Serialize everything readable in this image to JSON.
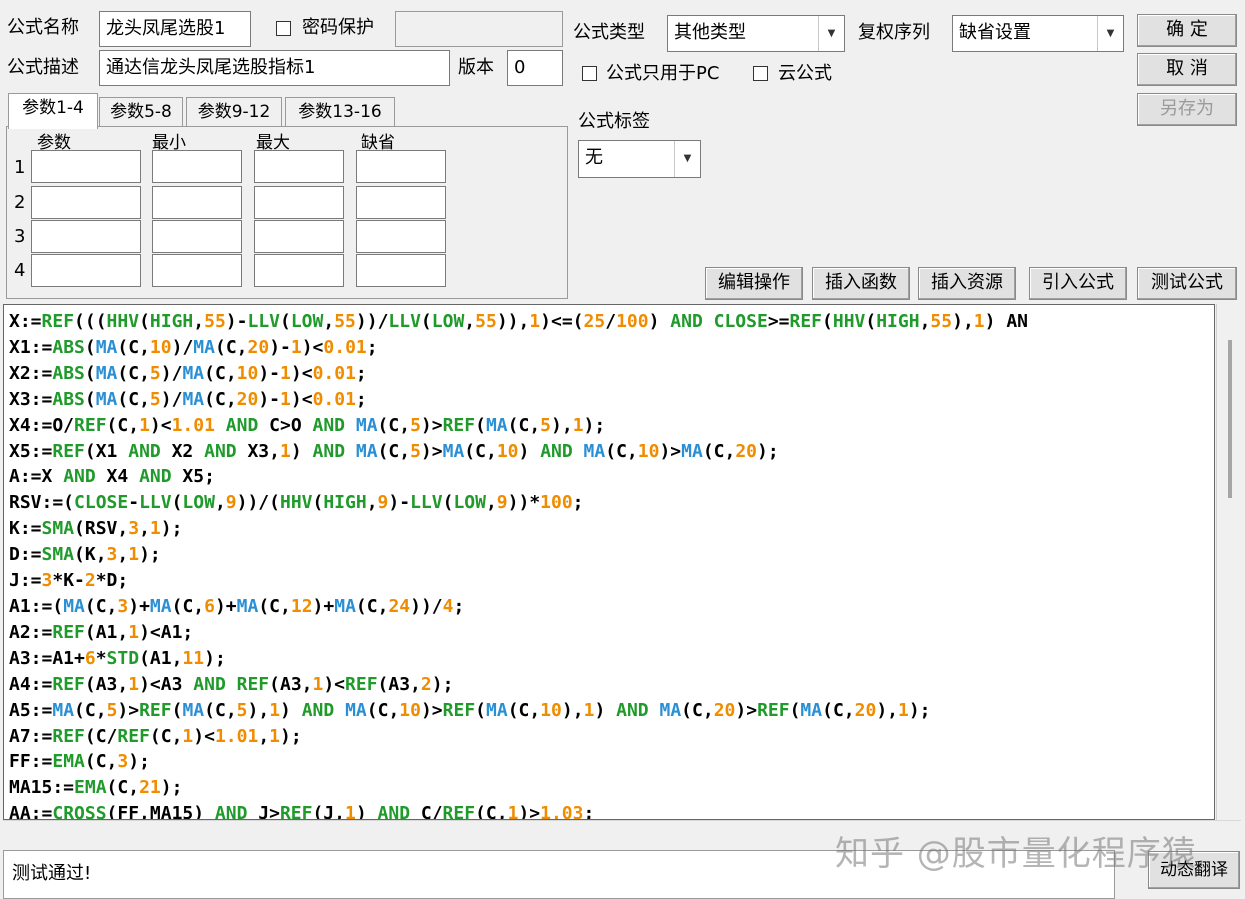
{
  "form": {
    "name_label": "公式名称",
    "name_value": "龙头凤尾选股1",
    "password_label": "密码保护",
    "password_checked": false,
    "password_value": "",
    "desc_label": "公式描述",
    "desc_value": "通达信龙头凤尾选股指标1",
    "version_label": "版本",
    "version_value": "0",
    "type_label": "公式类型",
    "type_value": "其他类型",
    "adjust_label": "复权序列",
    "adjust_value": "缺省设置",
    "pc_only_label": "公式只用于PC",
    "pc_only_checked": false,
    "cloud_label": "云公式",
    "cloud_checked": false,
    "tag_label": "公式标签",
    "tag_value": "无"
  },
  "buttons": {
    "ok": "确 定",
    "cancel": "取 消",
    "save_as": "另存为",
    "edit_ops": "编辑操作",
    "insert_func": "插入函数",
    "insert_res": "插入资源",
    "import_formula": "引入公式",
    "test_formula": "测试公式",
    "dynamic_translate": "动态翻译"
  },
  "params": {
    "tabs": [
      "参数1-4",
      "参数5-8",
      "参数9-12",
      "参数13-16"
    ],
    "active_tab": 0,
    "columns": [
      "参数",
      "最小",
      "最大",
      "缺省"
    ],
    "rows": [
      "1",
      "2",
      "3",
      "4"
    ]
  },
  "code_lines": [
    "X:=REF(((HHV(HIGH,55)-LLV(LOW,55))/LLV(LOW,55)),1)<=(25/100) AND CLOSE>=REF(HHV(HIGH,55),1) AN",
    "X1:=ABS(MA(C,10)/MA(C,20)-1)<0.01;",
    "X2:=ABS(MA(C,5)/MA(C,10)-1)<0.01;",
    "X3:=ABS(MA(C,5)/MA(C,20)-1)<0.01;",
    "X4:=O/REF(C,1)<1.01 AND C>O AND MA(C,5)>REF(MA(C,5),1);",
    "X5:=REF(X1 AND X2 AND X3,1) AND MA(C,5)>MA(C,10) AND MA(C,10)>MA(C,20);",
    "A:=X AND X4 AND X5;",
    "RSV:=(CLOSE-LLV(LOW,9))/(HHV(HIGH,9)-LLV(LOW,9))*100;",
    "K:=SMA(RSV,3,1);",
    "D:=SMA(K,3,1);",
    "J:=3*K-2*D;",
    "A1:=(MA(C,3)+MA(C,6)+MA(C,12)+MA(C,24))/4;",
    "A2:=REF(A1,1)<A1;",
    "A3:=A1+6*STD(A1,11);",
    "A4:=REF(A3,1)<A3 AND REF(A3,1)<REF(A3,2);",
    "A5:=MA(C,5)>REF(MA(C,5),1) AND MA(C,10)>REF(MA(C,10),1) AND MA(C,20)>REF(MA(C,20),1);",
    "A7:=REF(C/REF(C,1)<1.01,1);",
    "FF:=EMA(C,3);",
    "MA15:=EMA(C,21);",
    "AA:=CROSS(FF,MA15) AND J>REF(J,1) AND C/REF(C,1)>1.03;"
  ],
  "status_text": "测试通过!",
  "watermark": "知乎 @股市量化程序猿"
}
